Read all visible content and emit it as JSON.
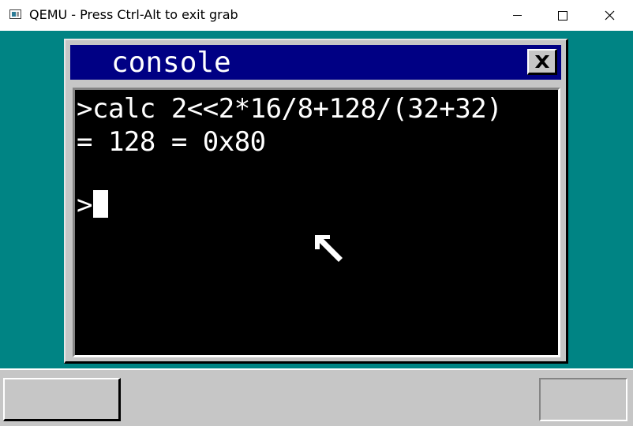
{
  "window": {
    "title": "QEMU - Press Ctrl-Alt to exit grab",
    "icon": "qemu-app-icon",
    "controls": [
      "minimize-icon",
      "maximize-icon",
      "close-icon"
    ]
  },
  "console": {
    "title": "console",
    "close_icon": "close-x-icon",
    "lines": [
      ">calc 2<<2*16/8+128/(32+32)",
      "= 128 = 0x80"
    ],
    "prompt": ">"
  },
  "colors": {
    "desktop": "#008484",
    "titlebar_active": "#000084",
    "console_bg": "#000000",
    "console_text": "#ffffff",
    "window_face": "#c6c6c6"
  }
}
